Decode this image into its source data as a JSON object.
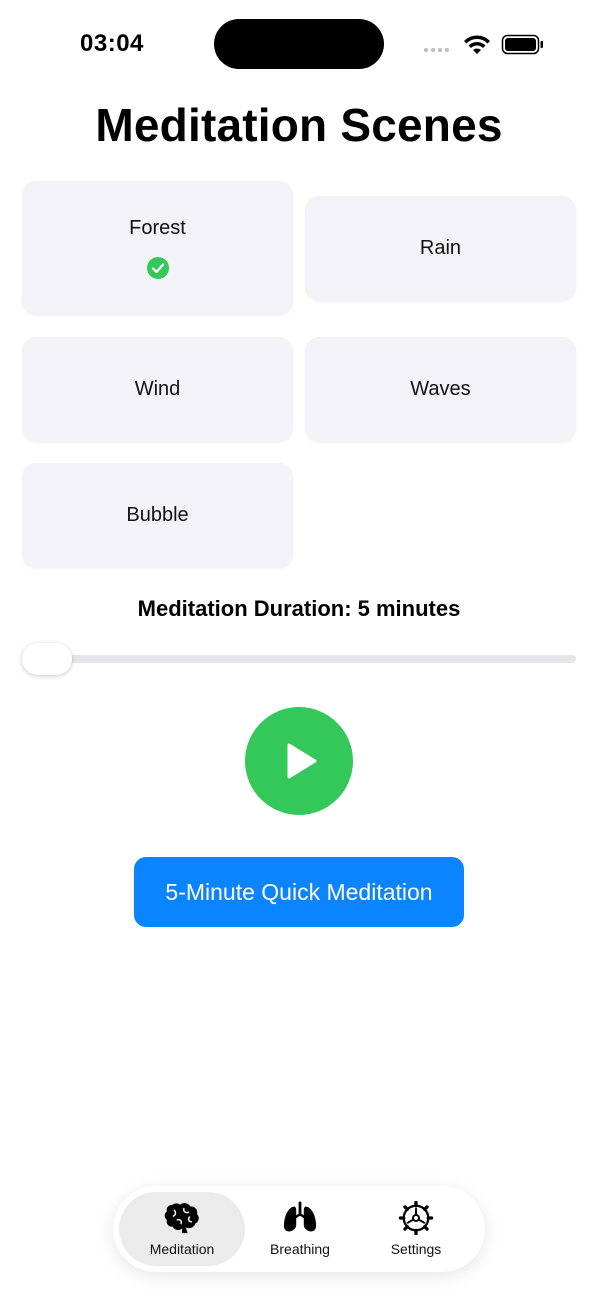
{
  "status": {
    "time": "03:04"
  },
  "page": {
    "title": "Meditation Scenes"
  },
  "scenes": [
    {
      "label": "Forest",
      "selected": true
    },
    {
      "label": "Rain",
      "selected": false
    },
    {
      "label": "Wind",
      "selected": false
    },
    {
      "label": "Waves",
      "selected": false
    },
    {
      "label": "Bubble",
      "selected": false
    }
  ],
  "duration": {
    "label": "Meditation Duration: 5 minutes",
    "slider_value": 0
  },
  "quick_button": {
    "label": "5-Minute Quick Meditation"
  },
  "tabs": [
    {
      "label": "Meditation",
      "icon": "brain-icon",
      "active": true
    },
    {
      "label": "Breathing",
      "icon": "lungs-icon",
      "active": false
    },
    {
      "label": "Settings",
      "icon": "gear-icon",
      "active": false
    }
  ],
  "colors": {
    "accent_green": "#34c759",
    "accent_blue": "#0a84ff",
    "card_bg": "#f2f2f7"
  }
}
